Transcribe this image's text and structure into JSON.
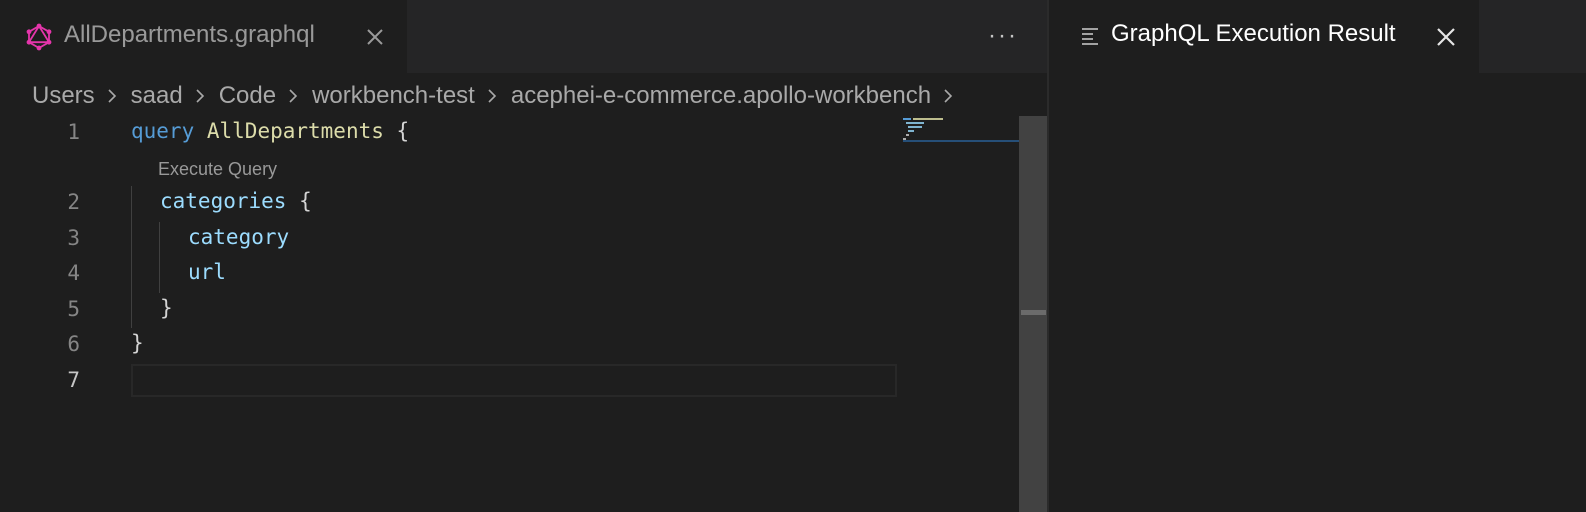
{
  "editor_tab": {
    "label": "AllDepartments.graphql",
    "icon": "graphql-icon",
    "accent_color": "#e535ab"
  },
  "editor_actions": {
    "more_label": "···"
  },
  "breadcrumb": [
    "Users",
    "saad",
    "Code",
    "workbench-test",
    "acephei-e-commerce.apollo-workbench"
  ],
  "codelens": {
    "label": "Execute Query"
  },
  "code": {
    "line_numbers": [
      "1",
      "2",
      "3",
      "4",
      "5",
      "6",
      "7"
    ],
    "l1_keyword": "query",
    "l1_name": "AllDepartments",
    "l1_brace": "{",
    "l2_field": "categories",
    "l2_brace": "{",
    "l3_field": "category",
    "l4_field": "url",
    "l5_brace": "}",
    "l6_brace": "}",
    "current_line": "7"
  },
  "result_tab": {
    "label": "GraphQL Execution Result",
    "icon": "preview-lines-icon"
  }
}
